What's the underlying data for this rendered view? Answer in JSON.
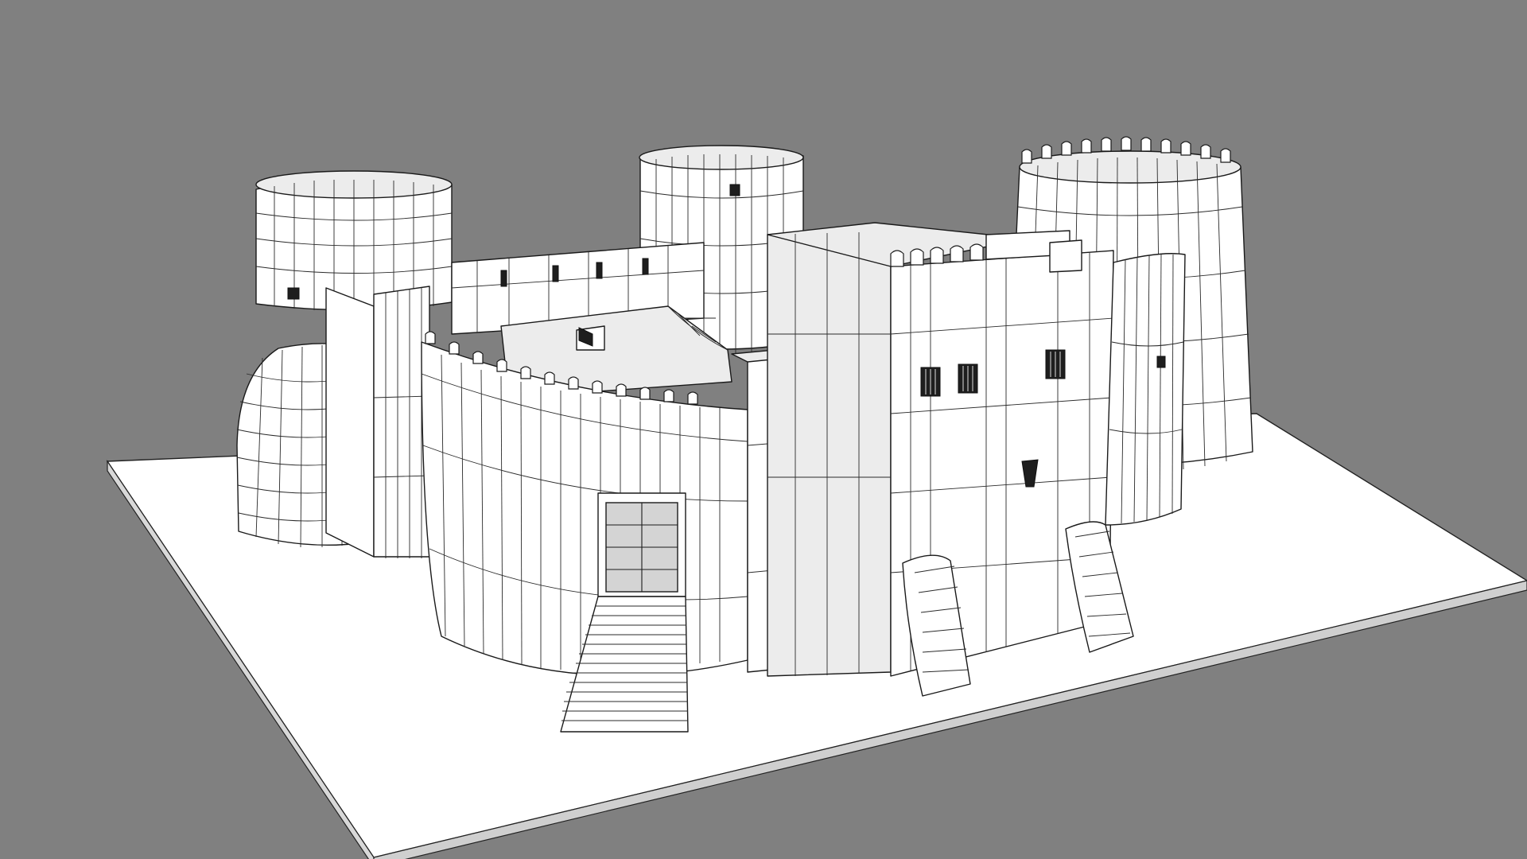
{
  "scene": {
    "background_color": "#808080",
    "base_color": "#ffffff",
    "model_color": "#ffffff",
    "wireframe_color": "#1a1a1a"
  }
}
